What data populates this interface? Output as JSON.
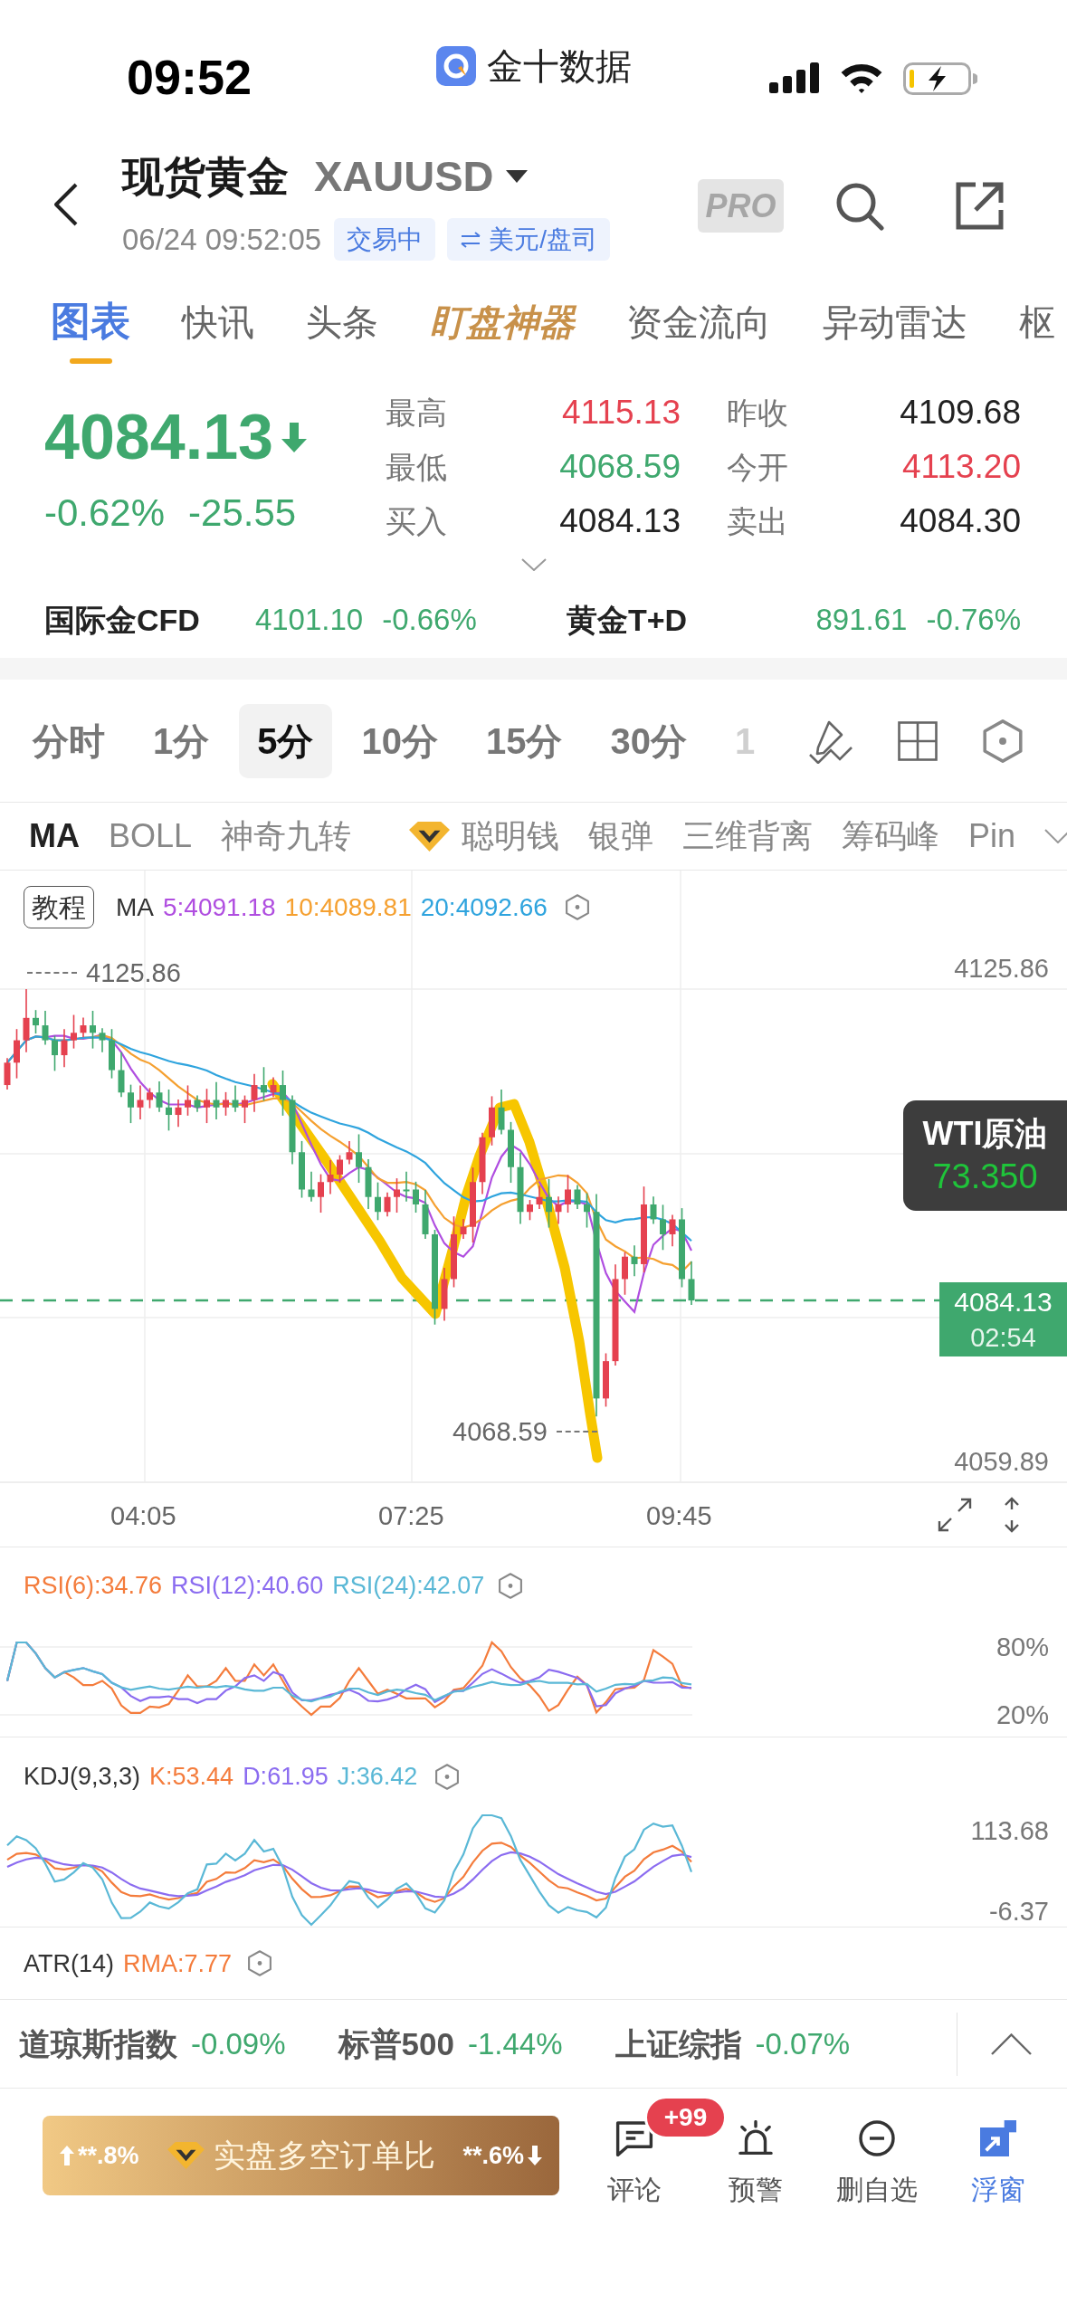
{
  "status_bar": {
    "time": "09:52",
    "app_name": "金十数据"
  },
  "header": {
    "title": "现货黄金",
    "symbol": "XAUUSD",
    "timestamp": "06/24 09:52:05",
    "status": "交易中",
    "unit": "美元/盘司",
    "pro": "PRO"
  },
  "tabs": [
    {
      "label": "图表",
      "selected": true,
      "kind": "normal"
    },
    {
      "label": "快讯",
      "selected": false,
      "kind": "normal"
    },
    {
      "label": "头条",
      "selected": false,
      "kind": "normal"
    },
    {
      "label": "盯盘神器",
      "selected": false,
      "kind": "featured"
    },
    {
      "label": "资金流向",
      "selected": false,
      "kind": "normal"
    },
    {
      "label": "异动雷达",
      "selected": false,
      "kind": "normal"
    },
    {
      "label": "枢",
      "selected": false,
      "kind": "normal"
    }
  ],
  "quote": {
    "price": "4084.13",
    "falling": true,
    "change_percent": "-0.62%",
    "change": "-25.55",
    "stats": [
      {
        "label": "最高",
        "value": "4115.13",
        "color": "#e5414f"
      },
      {
        "label": "昨收",
        "value": "4109.68",
        "color": "#222222"
      },
      {
        "label": "最低",
        "value": "4068.59",
        "color": "#3fa86e"
      },
      {
        "label": "今开",
        "value": "4113.20",
        "color": "#e5414f"
      },
      {
        "label": "买入",
        "value": "4084.13",
        "color": "#222222"
      },
      {
        "label": "卖出",
        "value": "4084.30",
        "color": "#222222"
      }
    ]
  },
  "related": [
    {
      "name": "国际金CFD",
      "price": "4101.10",
      "change": "-0.66%"
    },
    {
      "name": "黄金T+D",
      "price": "891.61",
      "change": "-0.76%"
    }
  ],
  "timeframes": [
    {
      "label": "分时",
      "selected": false
    },
    {
      "label": "1分",
      "selected": false
    },
    {
      "label": "5分",
      "selected": true
    },
    {
      "label": "10分",
      "selected": false
    },
    {
      "label": "15分",
      "selected": false
    },
    {
      "label": "30分",
      "selected": false
    },
    {
      "label": "1",
      "selected": false
    }
  ],
  "indicators": [
    {
      "label": "MA",
      "selected": true,
      "premium": false
    },
    {
      "label": "BOLL",
      "selected": false,
      "premium": false
    },
    {
      "label": "神奇九转",
      "selected": false,
      "premium": false
    },
    {
      "label": "聪明钱",
      "selected": false,
      "premium": true
    },
    {
      "label": "银弹",
      "selected": false,
      "premium": false
    },
    {
      "label": "三维背离",
      "selected": false,
      "premium": false
    },
    {
      "label": "筹码峰",
      "selected": false,
      "premium": false
    },
    {
      "label": "Pin",
      "selected": false,
      "premium": false
    }
  ],
  "chart": {
    "tutorial": "教程",
    "legend_title": "MA",
    "legend": [
      {
        "text": "5:4091.18",
        "color": "#b04ee0"
      },
      {
        "text": "10:4089.81",
        "color": "#f5a030"
      },
      {
        "text": "20:4092.66",
        "color": "#2fa4de"
      }
    ],
    "axis_high": "4125.86",
    "axis_low": "4059.89",
    "high_marker": "4125.86",
    "low_marker": "4068.59",
    "overlay": {
      "name": "WTI原油",
      "price": "73.350"
    },
    "last_price": "4084.13",
    "countdown": "02:54",
    "time_labels": [
      "04:05",
      "07:25",
      "09:45"
    ]
  },
  "rsi": {
    "legend": [
      {
        "text": "RSI(6):34.76",
        "color": "#f47c3c"
      },
      {
        "text": "RSI(12):40.60",
        "color": "#8b6cf0"
      },
      {
        "text": "RSI(24):42.07",
        "color": "#5ab8d6"
      }
    ],
    "levels": [
      "80%",
      "20%"
    ]
  },
  "kdj": {
    "title": "KDJ(9,3,3)",
    "legend": [
      {
        "text": "K:53.44",
        "color": "#f47c3c"
      },
      {
        "text": "D:61.95",
        "color": "#8b6cf0"
      },
      {
        "text": "J:36.42",
        "color": "#5ab8d6"
      }
    ],
    "axis": [
      "113.68",
      "-6.37"
    ]
  },
  "atr": {
    "title": "ATR(14)",
    "legend": [
      {
        "text": "RMA:7.77",
        "color": "#f47c3c"
      }
    ]
  },
  "tickers": [
    {
      "name": "道琼斯指数",
      "change": "-0.09%"
    },
    {
      "name": "标普500",
      "change": "-1.44%"
    },
    {
      "name": "上证综指",
      "change": "-0.07%"
    }
  ],
  "bottom_bar": {
    "ratio": {
      "long": "**.8%",
      "title": "实盘多空订单比",
      "short": "**.6%"
    },
    "actions": [
      {
        "label": "评论",
        "kind": "comment",
        "badge": "+99",
        "selected": false
      },
      {
        "label": "预警",
        "kind": "alert",
        "selected": false
      },
      {
        "label": "删自选",
        "kind": "remove",
        "selected": false
      },
      {
        "label": "浮窗",
        "kind": "float",
        "selected": true
      }
    ]
  }
}
